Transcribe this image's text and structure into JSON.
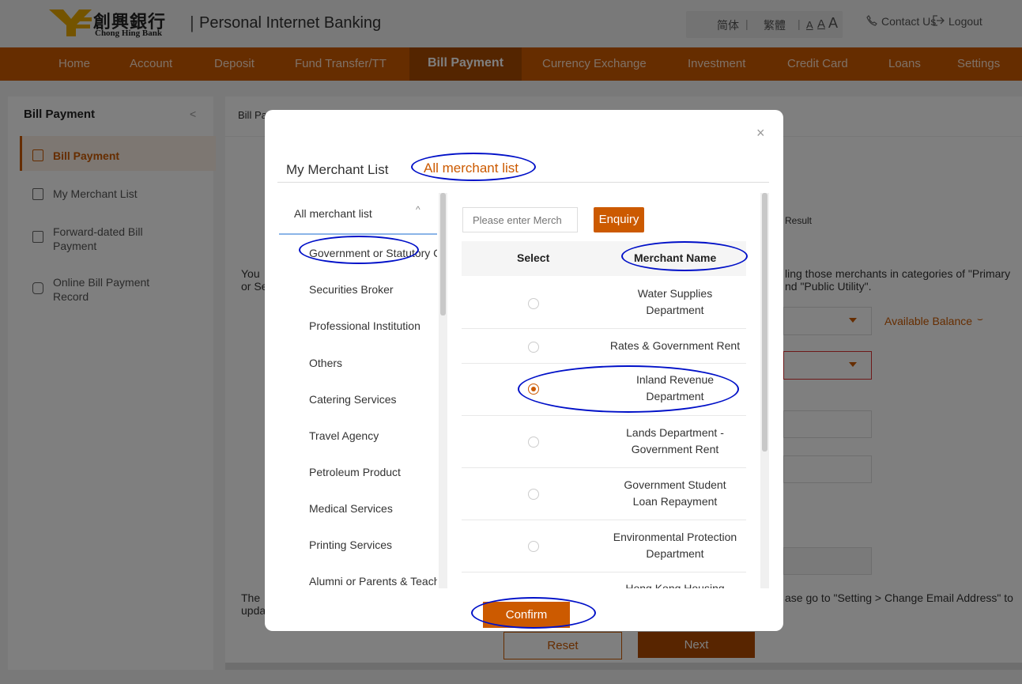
{
  "header": {
    "logo_cn": "創興銀行",
    "logo_en": "Chong Hing Bank",
    "app_title": "Personal Internet Banking",
    "lang_simplified": "简体",
    "lang_traditional": "繁體",
    "font_sizes": [
      "A",
      "A",
      "A"
    ],
    "contact_label": "Contact Us",
    "logout_label": "Logout"
  },
  "nav": {
    "items": [
      "Home",
      "Account",
      "Deposit",
      "Fund Transfer/TT",
      "Bill Payment",
      "Currency Exchange",
      "Investment",
      "Credit Card",
      "Loans",
      "Settings"
    ],
    "active": "Bill Payment"
  },
  "sidebar": {
    "title": "Bill Payment",
    "items": [
      {
        "label": "Bill Payment",
        "active": true
      },
      {
        "label": "My Merchant List",
        "active": false
      },
      {
        "label_line1": "Forward-dated Bill",
        "label_line2": "Payment",
        "active": false
      },
      {
        "label_line1": "Online Bill Payment",
        "label_line2": "Record",
        "active": false
      }
    ]
  },
  "main": {
    "breadcrumb": "Bill Pa",
    "step_result": "Result",
    "note_line1_left": "You",
    "note_line2_left": "or Se",
    "note_line1_right": "ling those merchants in categories of \"Primary",
    "note_line2_right": "nd \"Public Utility\".",
    "available_balance": "Available Balance",
    "email_line1_left": "The",
    "email_line2_left": "upda",
    "email_right": "ase go to \"Setting > Change Email Address\" to",
    "reset_label": "Reset",
    "next_label": "Next"
  },
  "modal": {
    "close_glyph": "×",
    "tab_my": "My Merchant List",
    "tab_all": "All merchant list",
    "category_header": "All merchant list",
    "categories": [
      "Government or Statutory C",
      "Securities Broker",
      "Professional Institution",
      "Others",
      "Catering Services",
      "Travel Agency",
      "Petroleum Product",
      "Medical Services",
      "Printing Services",
      "Alumni or Parents & Teach"
    ],
    "search_placeholder": "Please enter Merch",
    "enquiry_label": "Enquiry",
    "col_select": "Select",
    "col_name": "Merchant Name",
    "merchants": [
      {
        "line1": "Water Supplies",
        "line2": "Department",
        "selected": false
      },
      {
        "line1": "Rates & Government Rent",
        "line2": "",
        "selected": false
      },
      {
        "line1": "Inland Revenue",
        "line2": "Department",
        "selected": true
      },
      {
        "line1": "Lands Department -",
        "line2": "Government Rent",
        "selected": false
      },
      {
        "line1": "Government Student",
        "line2": "Loan Repayment",
        "selected": false
      },
      {
        "line1": "Environmental Protection",
        "line2": "Department",
        "selected": false
      },
      {
        "line1": "Hong Kong Housing",
        "line2": "",
        "selected": false
      }
    ],
    "confirm_label": "Confirm"
  },
  "colors": {
    "brand_orange": "#cc5a00",
    "nav_active": "#a84a00",
    "annotation_ring": "#0010c8"
  }
}
